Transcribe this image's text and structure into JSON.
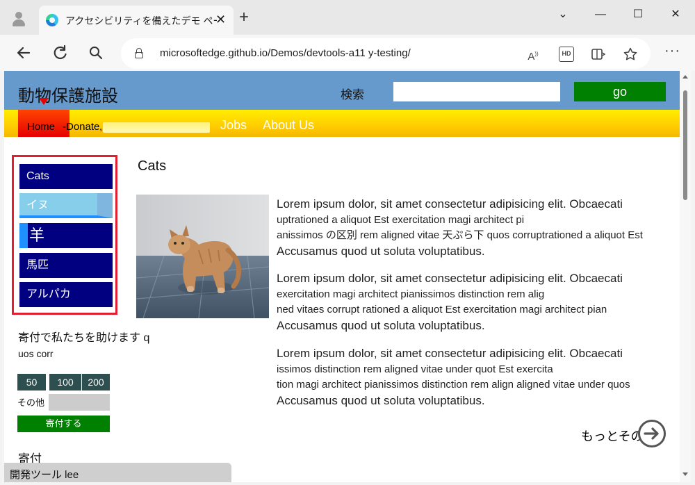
{
  "browser": {
    "tab_title": "アクセシビリティを備えたデモ ページは",
    "tab_close": "✕",
    "new_tab": "+",
    "url": "microsoftedge.github.io/Demos/devtools-a11 y-testing/",
    "window_controls": {
      "minimize": "—",
      "maximize": "☐",
      "close": "✕",
      "chevron": "⌄"
    }
  },
  "site": {
    "title": "動物保護施設",
    "search_label": "検索",
    "search_value": "",
    "go_label": "go"
  },
  "nav": {
    "home": "Home",
    "donate": "-Donate",
    "comma": ",",
    "jobs": "Jobs",
    "about": "About Us"
  },
  "sidebar": {
    "items": [
      {
        "label": "Cats"
      },
      {
        "label": "イヌ"
      },
      {
        "label": "羊"
      },
      {
        "label": "馬匹"
      },
      {
        "label": "アルパカ"
      }
    ]
  },
  "donate": {
    "text_line1": "寄付で私たちを助けます q",
    "text_line2": "uos corr",
    "amounts": [
      "50",
      "100",
      "200"
    ],
    "other_label": "その他",
    "other_value": "",
    "button": "寄付する"
  },
  "footer": {
    "heading": "寄付"
  },
  "main": {
    "title": "Cats",
    "paragraphs": [
      {
        "l1": "Lorem ipsum dolor, sit amet consectetur adipisicing elit. Obcaecati",
        "l2": "uptrationed a aliquot Est exercitation magi architect pi",
        "l3": "anissimos の区別 rem aligned vitae 天ぷら下 quos corruptrationed a aliquot Est",
        "l4": "Accusamus quod ut soluta voluptatibus."
      },
      {
        "l1": "Lorem ipsum dolor, sit amet consectetur adipisicing elit. Obcaecati",
        "l2": "exercitation magi architect pianissimos distinction rem alig",
        "l3": "ned vitaes corrupt rationed a aliquot Est exercitation magi architect pian",
        "l4": "Accusamus quod ut soluta voluptatibus."
      },
      {
        "l1": "Lorem ipsum dolor, sit amet consectetur adipisicing elit. Obcaecati",
        "l2": "issimos distinction rem aligned vitae under quot Est exercita",
        "l3": "tion magi architect pianissimos distinction rem align aligned vitae under quos",
        "l4": "Accusamus quod ut soluta voluptatibus."
      }
    ],
    "more_label": "もっとその"
  },
  "devtools": {
    "label": "開発ツール lee"
  },
  "colors": {
    "header_bg": "#6699cc",
    "nav_yellow": "#ffcc00",
    "nav_active_red": "#e60000",
    "sidebar_navy": "#000080",
    "highlight_border": "#e02030",
    "go_green": "#008000",
    "amount_bg": "#2d4f4f",
    "dog_item_bg": "#87ceeb"
  }
}
